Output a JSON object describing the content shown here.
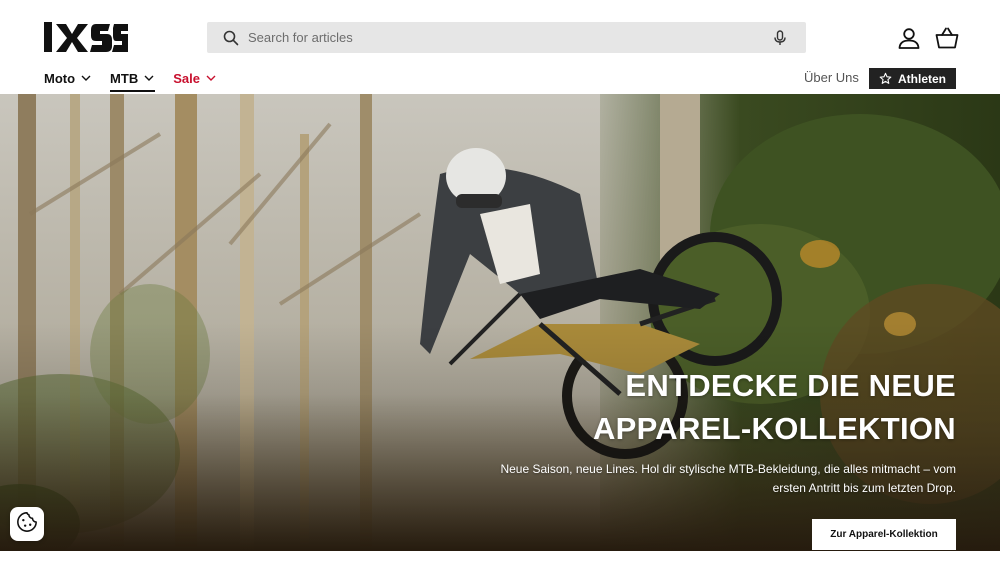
{
  "header": {
    "logo_text": "iXS",
    "search": {
      "placeholder": "Search for articles",
      "value": ""
    }
  },
  "nav": {
    "items": [
      {
        "label": "Moto",
        "active": false
      },
      {
        "label": "MTB",
        "active": true
      },
      {
        "label": "Sale",
        "active": false
      }
    ],
    "about_label": "Über Uns",
    "athletes_label": "Athleten"
  },
  "hero": {
    "title_line1": "ENTDECKE DIE NEUE",
    "title_line2": "APPAREL-KOLLEKTION",
    "subtitle": "Neue Saison, neue Lines. Hol dir stylische MTB-Bekleidung, die alles mitmacht – vom ersten Antritt bis zum letzten Drop.",
    "cta_label": "Zur Apparel-Kollektion"
  },
  "colors": {
    "sale": "#c8102e",
    "athletes_bg": "#222222",
    "search_bg": "#e6e6e6"
  },
  "icons": [
    "search-icon",
    "microphone-icon",
    "account-icon",
    "cart-icon",
    "chevron-down-icon",
    "star-icon",
    "cookie-icon"
  ]
}
